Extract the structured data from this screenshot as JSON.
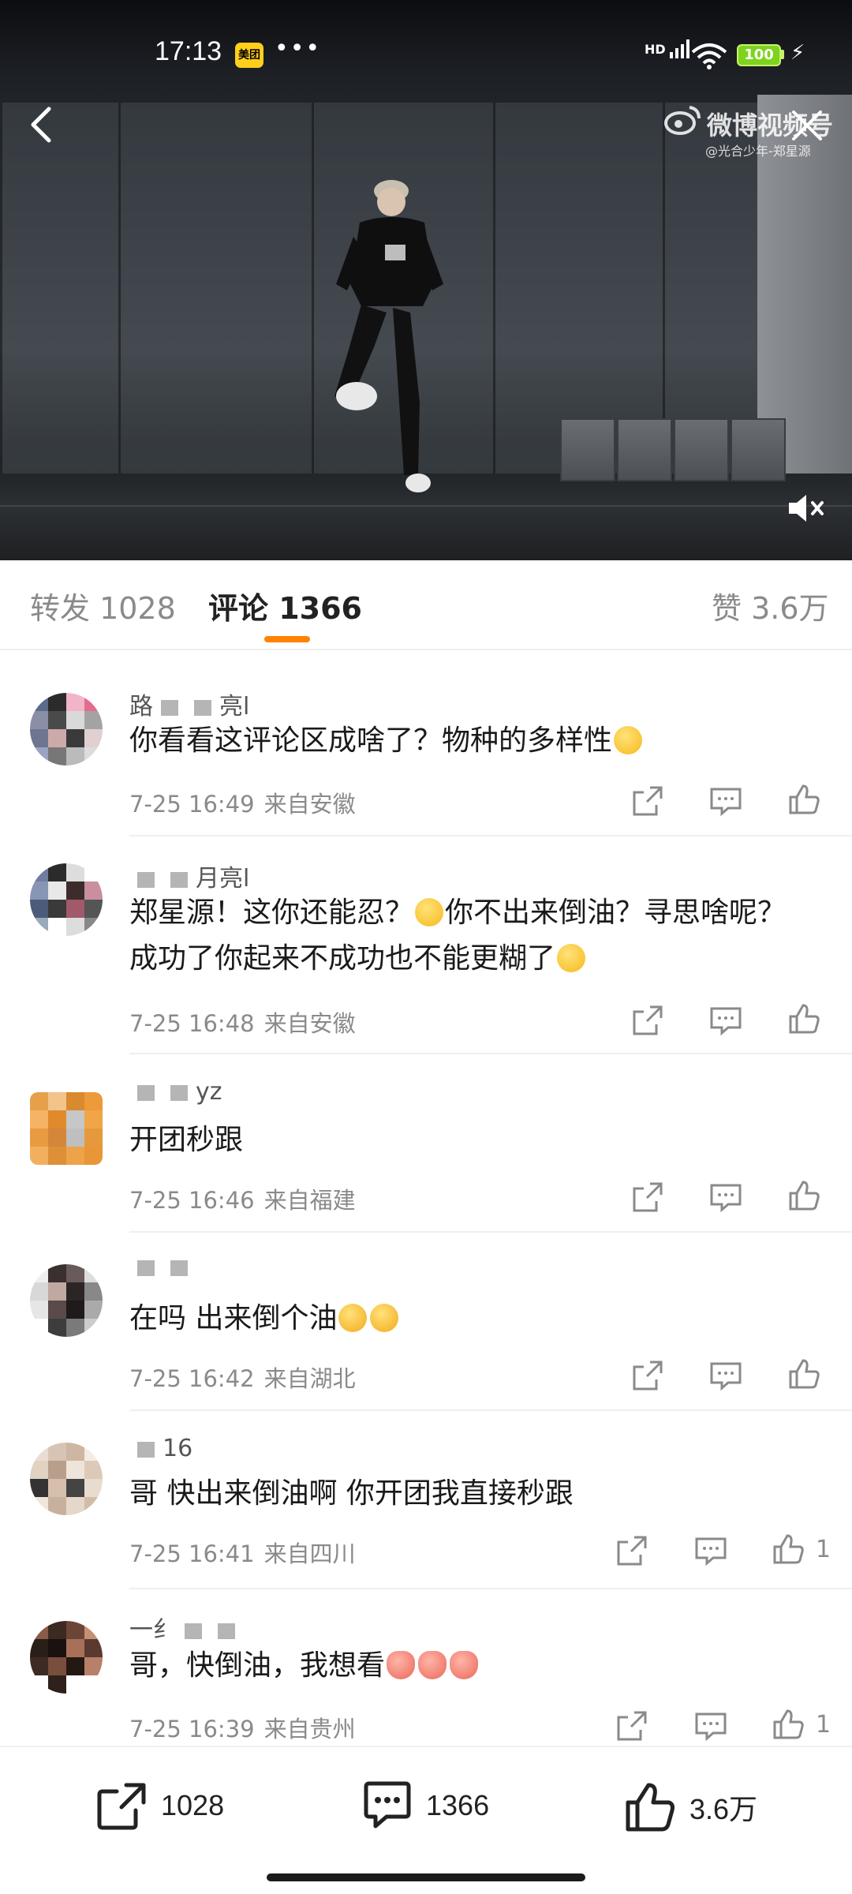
{
  "status_bar": {
    "time": "17:13",
    "app_badge": "美团",
    "more": "•••",
    "signal": "HD",
    "battery": "100"
  },
  "video": {
    "watermark": "微博视频号",
    "watermark_sub": "@光合少年-郑星源"
  },
  "tabs": {
    "repost": "转发 1028",
    "comments": "评论 1366",
    "likes": "赞 3.6万"
  },
  "comments": [
    {
      "name_start": "路",
      "name_end": "亮l",
      "text": "你看看这评论区成啥了？物种的多样性",
      "emoji": [
        "thinking"
      ],
      "time": "7-25 16:49",
      "location": "来自安徽",
      "likes": ""
    },
    {
      "name_start": "",
      "name_end": "月亮l",
      "text_a": "郑星源！这你还能忍？",
      "text_b": "你不出来倒油？寻思啥呢？成功了你起来不成功也不能更糊了",
      "time": "7-25 16:48",
      "location": "来自安徽",
      "likes": ""
    },
    {
      "name_start": "",
      "name_end": "yz",
      "text": "开团秒跟",
      "time": "7-25 16:46",
      "location": "来自福建",
      "likes": ""
    },
    {
      "name_start": "",
      "name_end": "",
      "text": "在吗 出来倒个油",
      "time": "7-25 16:42",
      "location": "来自湖北",
      "likes": ""
    },
    {
      "name_start": "",
      "name_end": "16",
      "text": "哥 快出来倒油啊 你开团我直接秒跟",
      "time": "7-25 16:41",
      "location": "来自四川",
      "likes": "1"
    },
    {
      "name_start": "一纟",
      "name_end": "",
      "text": "哥，快倒油，我想看",
      "time": "7-25 16:39",
      "location": "来自贵州",
      "likes": "1"
    }
  ],
  "bottom_bar": {
    "repost_count": "1028",
    "comment_count": "1366",
    "like_count": "3.6万"
  },
  "colors": {
    "accent": "#ff8200",
    "muted": "#8a8a8a",
    "text": "#1a1a1a"
  }
}
